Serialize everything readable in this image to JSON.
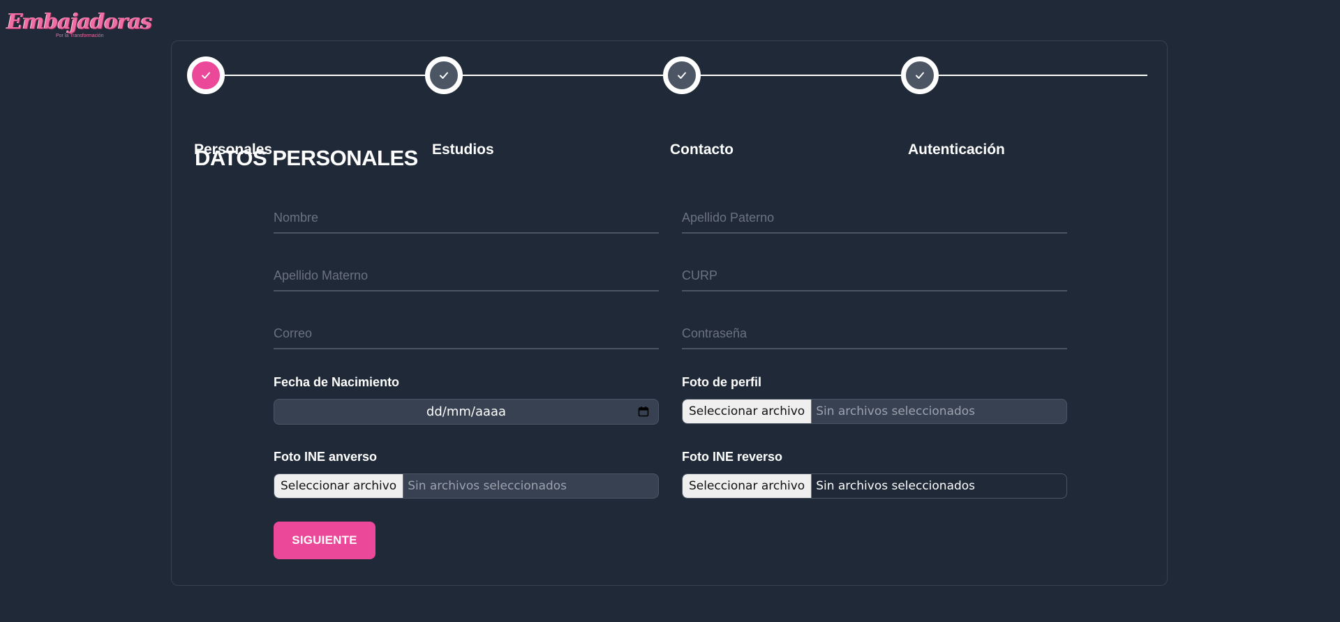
{
  "brand": {
    "logo_text": "Embajadoras",
    "logo_subtext": "Por la Transformación",
    "accent_color": "#ec4899",
    "background_color": "#1f2937"
  },
  "stepper": {
    "steps": [
      {
        "label": "Personales",
        "state": "active",
        "icon": "check-icon"
      },
      {
        "label": "Estudios",
        "state": "inactive",
        "icon": "check-icon"
      },
      {
        "label": "Contacto",
        "state": "inactive",
        "icon": "check-icon"
      },
      {
        "label": "Autenticación",
        "state": "inactive",
        "icon": "check-icon"
      }
    ]
  },
  "form": {
    "title": "DATOS PERSONALES",
    "nombre": {
      "placeholder": "Nombre",
      "value": ""
    },
    "apellido_paterno": {
      "placeholder": "Apellido Paterno",
      "value": ""
    },
    "apellido_materno": {
      "placeholder": "Apellido Materno",
      "value": ""
    },
    "curp": {
      "placeholder": "CURP",
      "value": ""
    },
    "correo": {
      "placeholder": "Correo",
      "value": ""
    },
    "contrasena": {
      "placeholder": "Contraseña",
      "value": ""
    },
    "fecha_nacimiento": {
      "label": "Fecha de Nacimiento",
      "value": "dd/mm/aaaa",
      "icon": "calendar-icon"
    },
    "foto_perfil": {
      "label": "Foto de perfil",
      "button": "Seleccionar archivo",
      "status": "Sin archivos seleccionados"
    },
    "ine_anverso": {
      "label": "Foto INE anverso",
      "button": "Seleccionar archivo",
      "status": "Sin archivos seleccionados"
    },
    "ine_reverso": {
      "label": "Foto INE reverso",
      "button": "Seleccionar archivo",
      "status": "Sin archivos seleccionados"
    },
    "submit_label": "SIGUIENTE"
  }
}
